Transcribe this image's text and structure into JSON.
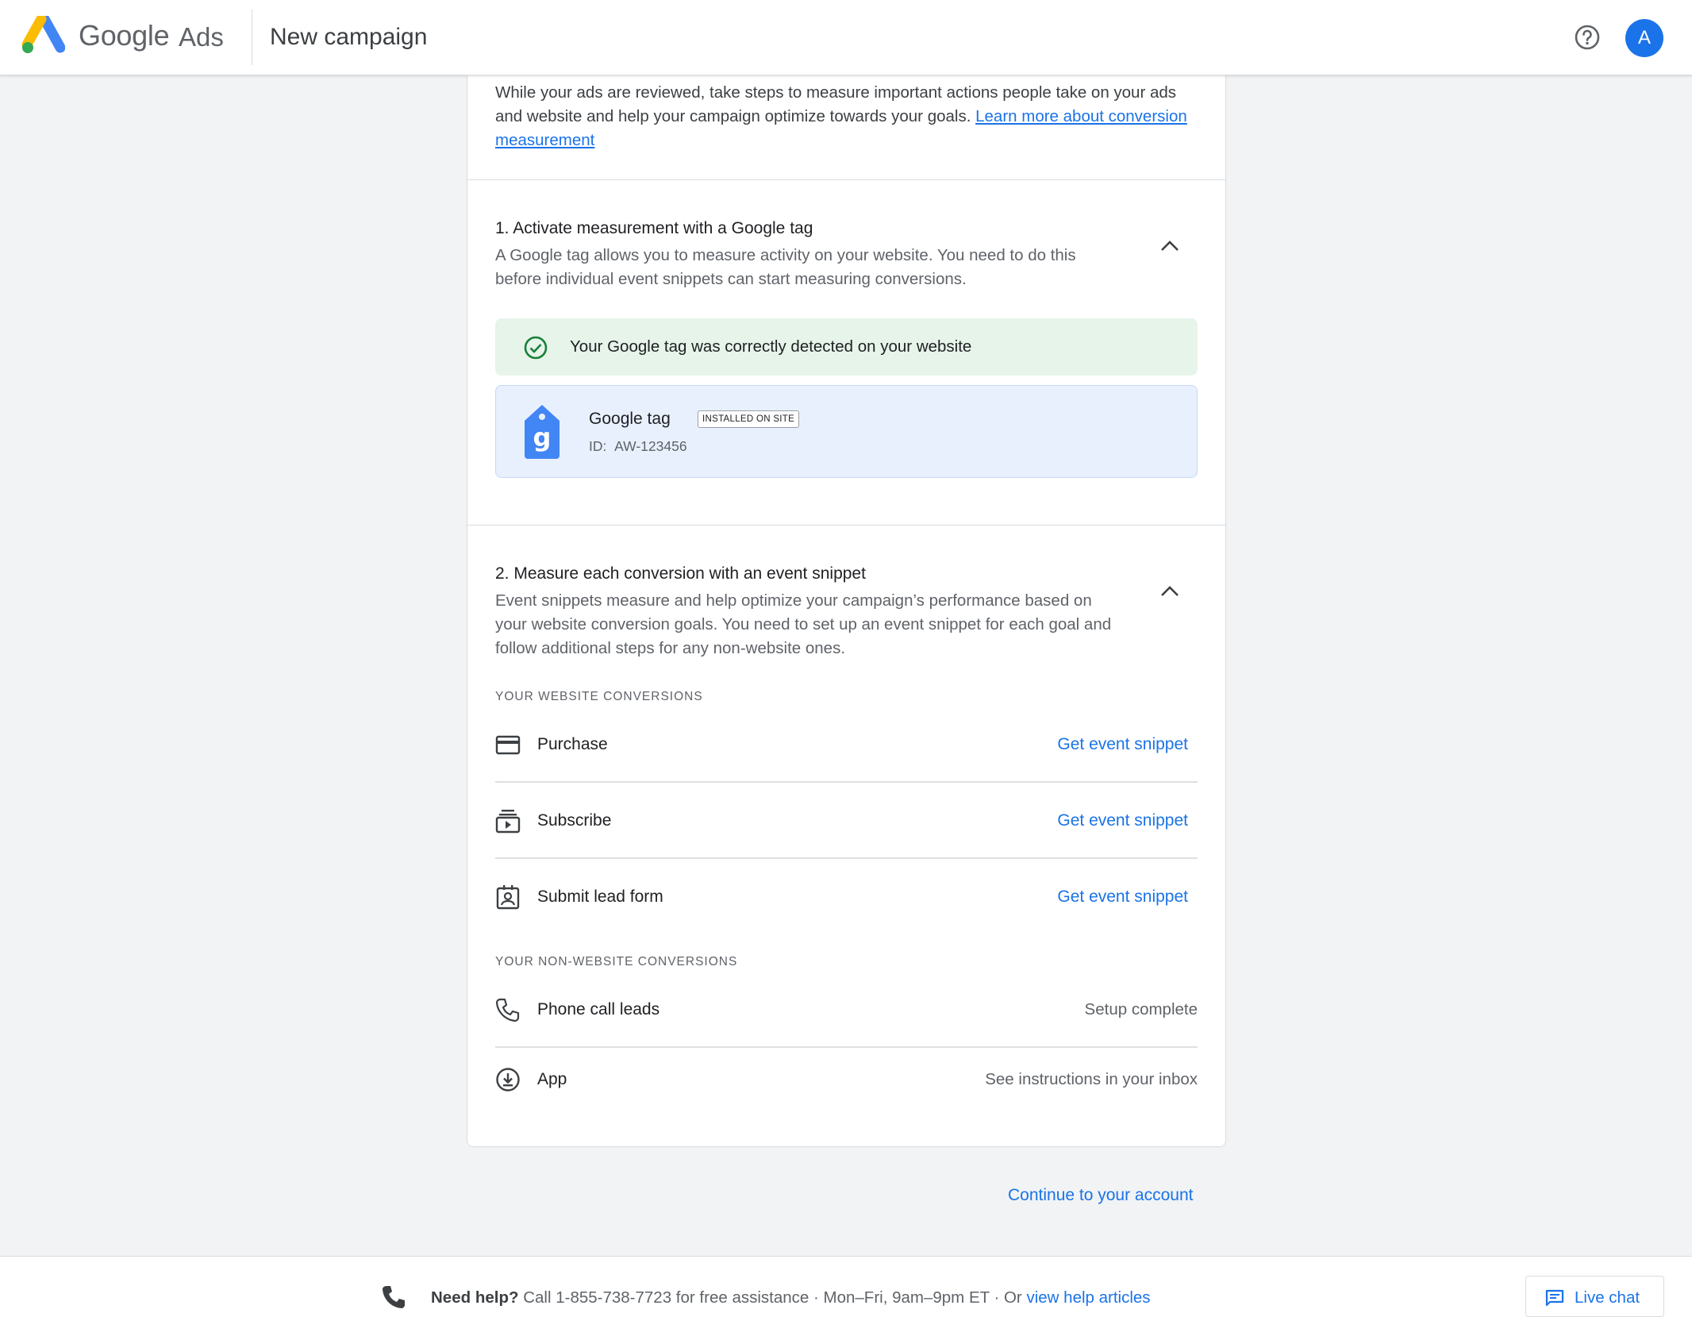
{
  "header": {
    "brand_google": "Google",
    "brand_ads": "Ads",
    "title": "New campaign",
    "avatar_initial": "A",
    "help_icon": "help-circle-icon"
  },
  "intro": {
    "text": "While your ads are reviewed, take steps to measure important actions people take on your ads and website and help your campaign optimize towards your goals.",
    "link_text": "Learn more about conversion measurement"
  },
  "step1": {
    "title": "1. Activate measurement with a Google tag",
    "description": "A Google tag allows you to measure activity on your website. You need to do this before individual event snippets can start measuring conversions.",
    "success_message": "Your Google tag was correctly detected on your website",
    "tag": {
      "name": "Google tag",
      "badge": "INSTALLED ON SITE",
      "id_label": "ID:",
      "id_value": "AW-123456"
    }
  },
  "step2": {
    "title": "2. Measure each conversion with an event snippet",
    "description": "Event snippets measure and help optimize your campaign’s performance based on your website conversion goals. You need to set up an event snippet for each goal and follow additional steps for any non-website ones.",
    "website_label": "YOUR WEBSITE CONVERSIONS",
    "website_conversions": [
      {
        "label": "Purchase",
        "icon": "credit-card-icon",
        "action": "Get event snippet"
      },
      {
        "label": "Subscribe",
        "icon": "subscriptions-icon",
        "action": "Get event snippet"
      },
      {
        "label": "Submit lead form",
        "icon": "contact-card-icon",
        "action": "Get event snippet"
      }
    ],
    "non_website_label": "YOUR NON-WEBSITE CONVERSIONS",
    "non_website_conversions": [
      {
        "label": "Phone call leads",
        "icon": "phone-icon",
        "status": "Setup complete"
      },
      {
        "label": "App",
        "icon": "download-circle-icon",
        "status": "See instructions in your inbox"
      }
    ]
  },
  "continue_label": "Continue to your account",
  "footer": {
    "need_help": "Need help?",
    "call_text": "Call 1-855-738-7723 for free assistance · Mon–Fri, 9am–9pm ET · Or",
    "help_link": "view help articles",
    "live_chat": "Live chat"
  },
  "colors": {
    "accent": "#1a73e8",
    "success_bg": "#e6f4ea",
    "success_icon": "#188038",
    "tag_bg": "#e8f0fe",
    "page_bg": "#f1f3f4"
  }
}
